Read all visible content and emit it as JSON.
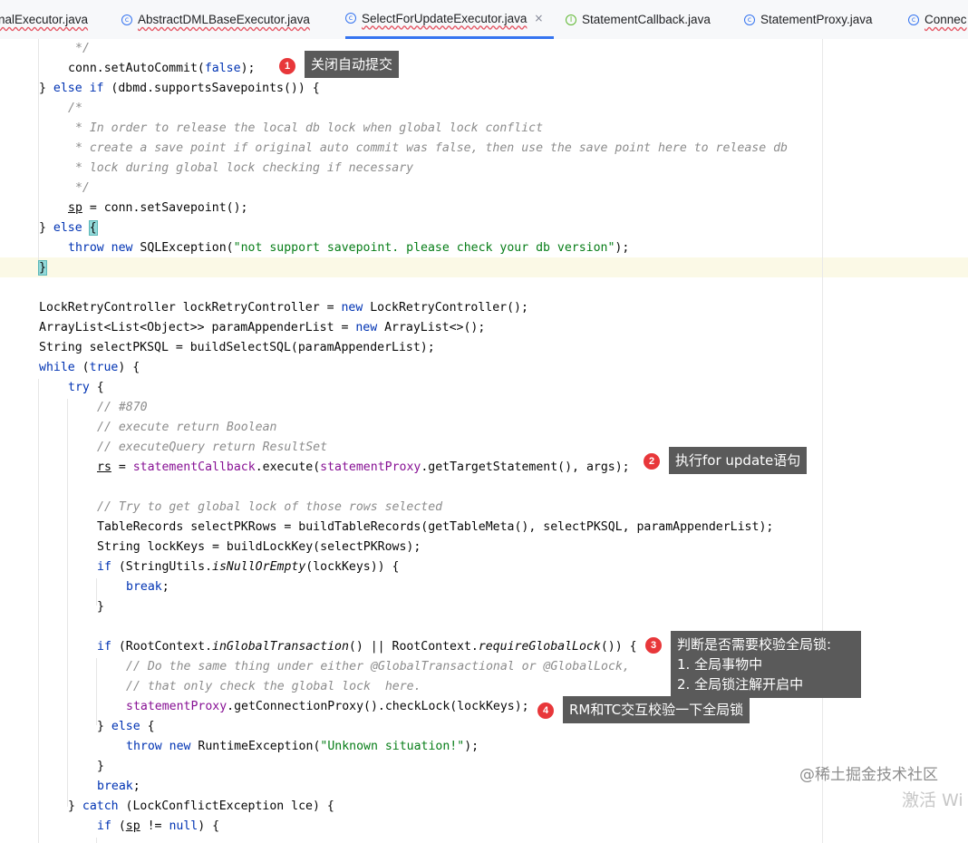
{
  "tabs": [
    {
      "label": "nalExecutor.java",
      "icon": "class-icon",
      "error": true
    },
    {
      "label": "AbstractDMLBaseExecutor.java",
      "icon": "class-icon",
      "error": true
    },
    {
      "label": "SelectForUpdateExecutor.java",
      "icon": "class-icon",
      "error": true,
      "active": true,
      "close": "×"
    },
    {
      "label": "StatementCallback.java",
      "icon": "interface-icon",
      "error": false
    },
    {
      "label": "StatementProxy.java",
      "icon": "class-icon",
      "error": false
    },
    {
      "label": "Connec",
      "icon": "class-icon",
      "error": true
    }
  ],
  "code": {
    "l1": "*/",
    "l2": [
      "conn.setAutoCommit(",
      "false",
      ");"
    ],
    "l3": [
      "} ",
      "else if",
      " (dbmd.supportsSavepoints()) {"
    ],
    "l4": "/*",
    "l5": " * In order to release the local db lock when global lock conflict",
    "l6": " * create a save point if original auto commit was false, then use the save point here to release db",
    "l7": " * lock during global lock checking if necessary",
    "l8": " */",
    "l9": [
      "sp",
      " = conn.setSavepoint();"
    ],
    "l10": [
      "} ",
      "else",
      " ",
      "{"
    ],
    "l11": [
      "throw new",
      " SQLException(",
      "\"not support savepoint. please check your db version\"",
      ");"
    ],
    "l12": "}",
    "l14": [
      "LockRetryController lockRetryController = ",
      "new",
      " LockRetryController();"
    ],
    "l15": [
      "ArrayList<List<Object>> paramAppenderList = ",
      "new",
      " ArrayList<>();"
    ],
    "l16": "String selectPKSQL = buildSelectSQL(paramAppenderList);",
    "l17": [
      "while",
      " (",
      "true",
      ") {"
    ],
    "l18": [
      "try",
      " {"
    ],
    "l19": "// #870",
    "l20": "// execute return Boolean",
    "l21": "// executeQuery return ResultSet",
    "l22": [
      "rs",
      " = ",
      "statementCallback",
      ".execute(",
      "statementProxy",
      ".getTargetStatement(), args);"
    ],
    "l24": "// Try to get global lock of those rows selected",
    "l25": "TableRecords selectPKRows = buildTableRecords(getTableMeta(), selectPKSQL, paramAppenderList);",
    "l26": "String lockKeys = buildLockKey(selectPKRows);",
    "l27": [
      "if",
      " (StringUtils.",
      "isNullOrEmpty",
      "(lockKeys)) {"
    ],
    "l28": [
      "break",
      ";"
    ],
    "l29": "}",
    "l31": [
      "if",
      " (RootContext.",
      "inGlobalTransaction",
      "() || RootContext.",
      "requireGlobalLock",
      "()) {"
    ],
    "l32": "// Do the same thing under either @GlobalTransactional or @GlobalLock,",
    "l33": "// that only check the global lock  here.",
    "l34": [
      "statementProxy",
      ".getConnectionProxy().checkLock(lockKeys);"
    ],
    "l35": [
      "} ",
      "else",
      " {"
    ],
    "l36": [
      "throw new",
      " RuntimeException(",
      "\"Unknown situation!\"",
      ");"
    ],
    "l37": "}",
    "l38": [
      "break",
      ";"
    ],
    "l39": [
      "} ",
      "catch",
      " (LockConflictException lce) {"
    ],
    "l40": [
      "if",
      " (",
      "sp",
      " != ",
      "null",
      ") {"
    ]
  },
  "annotations": [
    {
      "num": "1",
      "text": "关闭自动提交"
    },
    {
      "num": "2",
      "text": "执行for update语句"
    },
    {
      "num": "3",
      "text": "判断是否需要校验全局锁:\n1. 全局事物中\n2. 全局锁注解开启中"
    },
    {
      "num": "4",
      "text": "RM和TC交互校验一下全局锁"
    }
  ],
  "watermark": "@稀土掘金技术社区",
  "activate_text": "激活 Wi",
  "colors": {
    "keyword": "#0033b3",
    "comment": "#8c8c8c",
    "string": "#067d17",
    "field": "#871094",
    "badge": "#e8373a",
    "note_bg": "#5a5a5a"
  }
}
